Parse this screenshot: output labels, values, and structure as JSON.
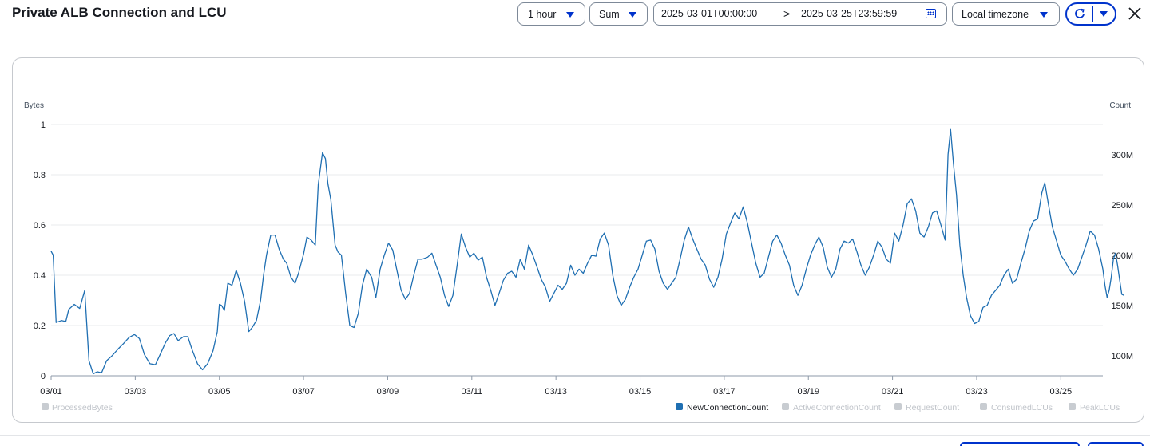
{
  "header": {
    "title": "Private ALB Connection and LCU",
    "period": "1 hour",
    "statistic": "Sum",
    "range_start": "2025-03-01T00:00:00",
    "range_arrow": ">",
    "range_end": "2025-03-25T23:59:59",
    "timezone": "Local timezone"
  },
  "icons": {
    "calendar": "calendar-icon",
    "refresh": "refresh-icon",
    "dropdown": "caret-down-icon",
    "close": "close-icon"
  },
  "colors": {
    "accent": "#0033cc",
    "series": "#1f6fb2",
    "disabled": "#c8ccd1"
  },
  "chart_data": {
    "type": "line",
    "title": "Private ALB Connection and LCU",
    "left_axis": {
      "label": "Bytes",
      "range": [
        0,
        1
      ],
      "ticks": [
        "0",
        "0.2",
        "0.4",
        "0.6",
        "0.8",
        "1"
      ]
    },
    "right_axis": {
      "label": "Count",
      "range": [
        80000000,
        330000000
      ],
      "ticks": [
        {
          "v": 100000000,
          "label": "100M"
        },
        {
          "v": 150000000,
          "label": "150M"
        },
        {
          "v": 200000000,
          "label": "200M"
        },
        {
          "v": 250000000,
          "label": "250M"
        },
        {
          "v": 300000000,
          "label": "300M"
        }
      ]
    },
    "x_axis": {
      "start": "2025-03-01T00:00:00",
      "end": "2025-03-26T00:00:00",
      "ticks": [
        {
          "day": 0,
          "label": "03/01"
        },
        {
          "day": 2,
          "label": "03/03"
        },
        {
          "day": 4,
          "label": "03/05"
        },
        {
          "day": 6,
          "label": "03/07"
        },
        {
          "day": 8,
          "label": "03/09"
        },
        {
          "day": 10,
          "label": "03/11"
        },
        {
          "day": 12,
          "label": "03/13"
        },
        {
          "day": 14,
          "label": "03/15"
        },
        {
          "day": 16,
          "label": "03/17"
        },
        {
          "day": 18,
          "label": "03/19"
        },
        {
          "day": 20,
          "label": "03/21"
        },
        {
          "day": 22,
          "label": "03/23"
        },
        {
          "day": 24,
          "label": "03/25"
        }
      ]
    },
    "grid": true,
    "legend_position": "bottom",
    "legend_left": [
      {
        "name": "ProcessedBytes",
        "active": false
      }
    ],
    "legend_right": [
      {
        "name": "NewConnectionCount",
        "active": true
      },
      {
        "name": "ActiveConnectionCount",
        "active": false
      },
      {
        "name": "RequestCount",
        "active": false
      },
      {
        "name": "ConsumedLCUs",
        "active": false
      },
      {
        "name": "PeakLCUs",
        "active": false
      }
    ],
    "series": [
      {
        "name": "NewConnectionCount",
        "axis": "right",
        "x_unit": "days since 2025-03-01T00:00",
        "points": [
          [
            0.0,
            204
          ],
          [
            0.05,
            200
          ],
          [
            0.12,
            133
          ],
          [
            0.25,
            135
          ],
          [
            0.35,
            134
          ],
          [
            0.42,
            146
          ],
          [
            0.55,
            151
          ],
          [
            0.68,
            147
          ],
          [
            0.8,
            165
          ],
          [
            0.9,
            95
          ],
          [
            1.0,
            82
          ],
          [
            1.1,
            84
          ],
          [
            1.2,
            83
          ],
          [
            1.32,
            95
          ],
          [
            1.45,
            100
          ],
          [
            1.6,
            107
          ],
          [
            1.72,
            112
          ],
          [
            1.85,
            118
          ],
          [
            1.98,
            121
          ],
          [
            2.1,
            117
          ],
          [
            2.22,
            101
          ],
          [
            2.35,
            92
          ],
          [
            2.48,
            91
          ],
          [
            2.6,
            102
          ],
          [
            2.72,
            113
          ],
          [
            2.82,
            120
          ],
          [
            2.92,
            122
          ],
          [
            3.02,
            115
          ],
          [
            3.15,
            119
          ],
          [
            3.25,
            119
          ],
          [
            3.35,
            106
          ],
          [
            3.48,
            92
          ],
          [
            3.6,
            86
          ],
          [
            3.72,
            92
          ],
          [
            3.85,
            105
          ],
          [
            3.95,
            124
          ],
          [
            4.0,
            151
          ],
          [
            4.05,
            150
          ],
          [
            4.12,
            145
          ],
          [
            4.2,
            172
          ],
          [
            4.3,
            170
          ],
          [
            4.4,
            185
          ],
          [
            4.5,
            172
          ],
          [
            4.6,
            154
          ],
          [
            4.7,
            124
          ],
          [
            4.78,
            128
          ],
          [
            4.88,
            135
          ],
          [
            4.98,
            155
          ],
          [
            5.05,
            180
          ],
          [
            5.12,
            200
          ],
          [
            5.22,
            220
          ],
          [
            5.32,
            220
          ],
          [
            5.42,
            206
          ],
          [
            5.52,
            196
          ],
          [
            5.6,
            192
          ],
          [
            5.7,
            178
          ],
          [
            5.8,
            172
          ],
          [
            5.88,
            182
          ],
          [
            6.0,
            201
          ],
          [
            6.08,
            218
          ],
          [
            6.18,
            215
          ],
          [
            6.28,
            210
          ],
          [
            6.35,
            270
          ],
          [
            6.45,
            302
          ],
          [
            6.52,
            296
          ],
          [
            6.58,
            271
          ],
          [
            6.65,
            255
          ],
          [
            6.75,
            210
          ],
          [
            6.82,
            203
          ],
          [
            6.9,
            200
          ],
          [
            7.0,
            162
          ],
          [
            7.1,
            130
          ],
          [
            7.2,
            128
          ],
          [
            7.3,
            142
          ],
          [
            7.4,
            170
          ],
          [
            7.5,
            186
          ],
          [
            7.62,
            178
          ],
          [
            7.72,
            158
          ],
          [
            7.82,
            186
          ],
          [
            7.92,
            200
          ],
          [
            8.02,
            212
          ],
          [
            8.12,
            205
          ],
          [
            8.22,
            185
          ],
          [
            8.32,
            165
          ],
          [
            8.42,
            156
          ],
          [
            8.52,
            162
          ],
          [
            8.62,
            180
          ],
          [
            8.72,
            196
          ],
          [
            8.82,
            196
          ],
          [
            8.95,
            198
          ],
          [
            9.05,
            202
          ],
          [
            9.15,
            190
          ],
          [
            9.25,
            178
          ],
          [
            9.35,
            160
          ],
          [
            9.45,
            149
          ],
          [
            9.55,
            160
          ],
          [
            9.65,
            190
          ],
          [
            9.75,
            221
          ],
          [
            9.85,
            208
          ],
          [
            9.95,
            198
          ],
          [
            10.05,
            202
          ],
          [
            10.15,
            195
          ],
          [
            10.25,
            198
          ],
          [
            10.35,
            178
          ],
          [
            10.45,
            165
          ],
          [
            10.55,
            150
          ],
          [
            10.65,
            162
          ],
          [
            10.75,
            175
          ],
          [
            10.85,
            182
          ],
          [
            10.95,
            184
          ],
          [
            11.05,
            178
          ],
          [
            11.15,
            196
          ],
          [
            11.25,
            186
          ],
          [
            11.35,
            210
          ],
          [
            11.45,
            200
          ],
          [
            11.55,
            188
          ],
          [
            11.65,
            176
          ],
          [
            11.75,
            168
          ],
          [
            11.85,
            154
          ],
          [
            11.95,
            162
          ],
          [
            12.05,
            170
          ],
          [
            12.15,
            166
          ],
          [
            12.25,
            172
          ],
          [
            12.35,
            190
          ],
          [
            12.45,
            180
          ],
          [
            12.55,
            186
          ],
          [
            12.65,
            182
          ],
          [
            12.75,
            192
          ],
          [
            12.85,
            200
          ],
          [
            12.95,
            199
          ],
          [
            13.05,
            216
          ],
          [
            13.15,
            222
          ],
          [
            13.25,
            210
          ],
          [
            13.35,
            180
          ],
          [
            13.45,
            160
          ],
          [
            13.55,
            150
          ],
          [
            13.65,
            156
          ],
          [
            13.75,
            168
          ],
          [
            13.85,
            178
          ],
          [
            13.95,
            186
          ],
          [
            14.05,
            200
          ],
          [
            14.15,
            214
          ],
          [
            14.25,
            215
          ],
          [
            14.35,
            206
          ],
          [
            14.45,
            184
          ],
          [
            14.55,
            172
          ],
          [
            14.65,
            166
          ],
          [
            14.75,
            172
          ],
          [
            14.85,
            178
          ],
          [
            14.95,
            196
          ],
          [
            15.05,
            215
          ],
          [
            15.15,
            228
          ],
          [
            15.25,
            216
          ],
          [
            15.35,
            206
          ],
          [
            15.45,
            196
          ],
          [
            15.55,
            190
          ],
          [
            15.65,
            176
          ],
          [
            15.75,
            168
          ],
          [
            15.85,
            178
          ],
          [
            15.95,
            196
          ],
          [
            16.05,
            221
          ],
          [
            16.15,
            232
          ],
          [
            16.25,
            242
          ],
          [
            16.35,
            236
          ],
          [
            16.45,
            248
          ],
          [
            16.55,
            232
          ],
          [
            16.65,
            212
          ],
          [
            16.75,
            192
          ],
          [
            16.85,
            178
          ],
          [
            16.95,
            182
          ],
          [
            17.05,
            198
          ],
          [
            17.15,
            214
          ],
          [
            17.25,
            220
          ],
          [
            17.35,
            212
          ],
          [
            17.45,
            200
          ],
          [
            17.55,
            190
          ],
          [
            17.65,
            170
          ],
          [
            17.75,
            160
          ],
          [
            17.85,
            170
          ],
          [
            17.95,
            186
          ],
          [
            18.05,
            200
          ],
          [
            18.15,
            210
          ],
          [
            18.25,
            218
          ],
          [
            18.35,
            208
          ],
          [
            18.45,
            188
          ],
          [
            18.55,
            178
          ],
          [
            18.65,
            186
          ],
          [
            18.75,
            206
          ],
          [
            18.85,
            214
          ],
          [
            18.95,
            212
          ],
          [
            19.05,
            216
          ],
          [
            19.15,
            204
          ],
          [
            19.25,
            190
          ],
          [
            19.35,
            180
          ],
          [
            19.45,
            188
          ],
          [
            19.55,
            200
          ],
          [
            19.65,
            214
          ],
          [
            19.75,
            208
          ],
          [
            19.85,
            196
          ],
          [
            19.95,
            192
          ],
          [
            20.05,
            222
          ],
          [
            20.15,
            214
          ],
          [
            20.25,
            230
          ],
          [
            20.35,
            251
          ],
          [
            20.45,
            256
          ],
          [
            20.55,
            244
          ],
          [
            20.65,
            222
          ],
          [
            20.75,
            218
          ],
          [
            20.85,
            228
          ],
          [
            20.95,
            242
          ],
          [
            21.05,
            244
          ],
          [
            21.15,
            230
          ],
          [
            21.25,
            215
          ],
          [
            21.32,
            300
          ],
          [
            21.38,
            325
          ],
          [
            21.45,
            290
          ],
          [
            21.52,
            260
          ],
          [
            21.6,
            210
          ],
          [
            21.68,
            180
          ],
          [
            21.76,
            158
          ],
          [
            21.85,
            140
          ],
          [
            21.95,
            132
          ],
          [
            22.05,
            134
          ],
          [
            22.15,
            148
          ],
          [
            22.25,
            150
          ],
          [
            22.35,
            160
          ],
          [
            22.45,
            165
          ],
          [
            22.55,
            170
          ],
          [
            22.65,
            180
          ],
          [
            22.75,
            186
          ],
          [
            22.85,
            172
          ],
          [
            22.95,
            176
          ],
          [
            23.05,
            192
          ],
          [
            23.15,
            206
          ],
          [
            23.25,
            224
          ],
          [
            23.35,
            234
          ],
          [
            23.45,
            236
          ],
          [
            23.55,
            262
          ],
          [
            23.62,
            272
          ],
          [
            23.7,
            252
          ],
          [
            23.8,
            228
          ],
          [
            23.9,
            214
          ],
          [
            24.0,
            200
          ],
          [
            24.1,
            194
          ],
          [
            24.2,
            186
          ],
          [
            24.3,
            180
          ],
          [
            24.4,
            186
          ],
          [
            24.5,
            198
          ],
          [
            24.6,
            210
          ],
          [
            24.7,
            224
          ],
          [
            24.8,
            220
          ],
          [
            24.9,
            206
          ],
          [
            25.0,
            186
          ],
          [
            25.05,
            170
          ],
          [
            25.1,
            158
          ],
          [
            25.15,
            165
          ],
          [
            25.2,
            178
          ],
          [
            25.25,
            196
          ],
          [
            25.3,
            202
          ],
          [
            25.35,
            190
          ],
          [
            25.4,
            175
          ],
          [
            25.45,
            161
          ],
          [
            25.5,
            160
          ]
        ]
      }
    ]
  }
}
